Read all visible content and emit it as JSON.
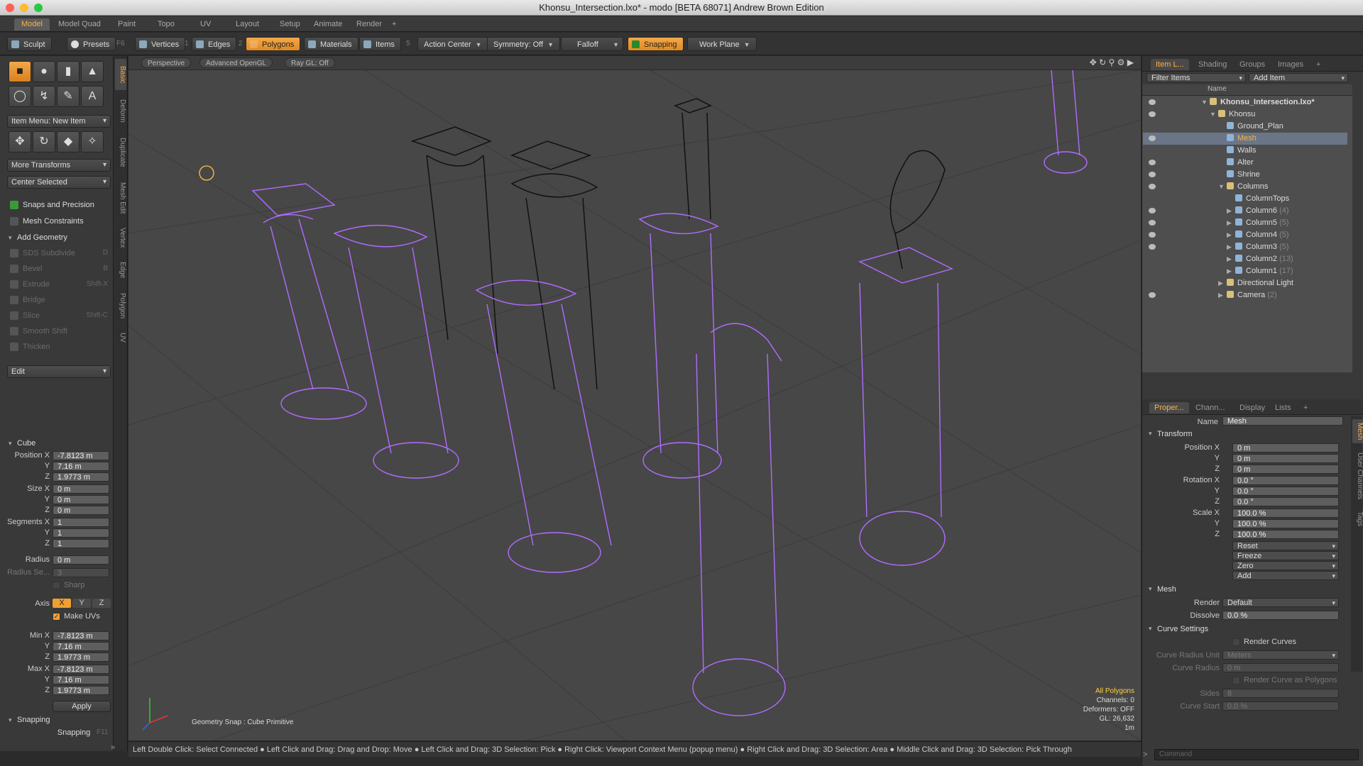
{
  "window": {
    "title": "Khonsu_Intersection.lxo* - modo [BETA 68071] Andrew Brown Edition"
  },
  "tabs": [
    "Model",
    "Model Quad",
    "Paint",
    "Topo",
    "UV",
    "Layout",
    "Setup",
    "Animate",
    "Render",
    "+"
  ],
  "toolbar": {
    "sculpt": "Sculpt",
    "presets": "Presets",
    "presets_key": "F6",
    "vertices": "Vertices",
    "vertices_key": "1",
    "edges": "Edges",
    "edges_key": "2",
    "polygons": "Polygons",
    "materials": "Materials",
    "items": "Items",
    "items_key": "5",
    "action_center": "Action Center",
    "symmetry": "Symmetry: Off",
    "falloff": "Falloff",
    "snapping": "Snapping",
    "work_plane": "Work Plane"
  },
  "left": {
    "vtabs": [
      "Basic",
      "Deform",
      "Duplicate",
      "Mesh Edit",
      "Vertex",
      "Edge",
      "Polygon",
      "UV"
    ],
    "item_menu": "Item Menu: New Item",
    "more_transforms": "More Transforms",
    "center_selected": "Center Selected",
    "snaps_precision": "Snaps and Precision",
    "mesh_constraints": "Mesh Constraints",
    "add_geometry": "Add Geometry",
    "tools": [
      {
        "label": "SDS Subdivide",
        "key": "D"
      },
      {
        "label": "Bevel",
        "key": "B"
      },
      {
        "label": "Extrude",
        "key": "Shift-X"
      },
      {
        "label": "Bridge",
        "key": ""
      },
      {
        "label": "Slice",
        "key": "Shift-C"
      },
      {
        "label": "Smooth Shift",
        "key": ""
      },
      {
        "label": "Thicken",
        "key": ""
      }
    ],
    "edit": "Edit",
    "cube": {
      "title": "Cube",
      "position_x_label": "Position X",
      "y_label": "Y",
      "z_label": "Z",
      "position": [
        "-7.8123 m",
        "7.16 m",
        "1.9773 m"
      ],
      "size_x_label": "Size X",
      "size": [
        "0 m",
        "0 m",
        "0 m"
      ],
      "segments_x_label": "Segments X",
      "segments": [
        "1",
        "1",
        "1"
      ],
      "radius_label": "Radius",
      "radius": "0 m",
      "radius_seg_label": "Radius Se...",
      "radius_seg": "3",
      "sharp_label": "Sharp",
      "axis_label": "Axis",
      "axis": [
        "X",
        "Y",
        "Z"
      ],
      "make_uvs": "Make UVs",
      "min_x_label": "Min X",
      "min": [
        "-7.8123 m",
        "7.16 m",
        "1.9773 m"
      ],
      "max_x_label": "Max X",
      "max": [
        "-7.8123 m",
        "7.16 m",
        "1.9773 m"
      ],
      "apply": "Apply"
    },
    "snapping_section": "Snapping",
    "snapping_btn": "Snapping",
    "snapping_key": "F11"
  },
  "viewport": {
    "labels": [
      "Perspective",
      "Advanced OpenGL",
      "Ray GL: Off"
    ],
    "geometry_snap": "Geometry Snap : Cube Primitive",
    "info": [
      "All Polygons",
      "Channels: 0",
      "Deformers: OFF",
      "GL: 26,632",
      "1m"
    ],
    "accent": "#b06cff"
  },
  "statusbar": "Left Double Click: Select Connected ● Left Click and Drag: Drag and Drop: Move ● Left Click and Drag: 3D Selection: Pick ● Right Click: Viewport Context Menu (popup menu) ● Right Click and Drag: 3D Selection: Area ● Middle Click and Drag: 3D Selection: Pick Through",
  "items_panel": {
    "tabs": [
      "Item L...",
      "Shading",
      "Groups",
      "Images",
      "+"
    ],
    "filter": "Filter Items",
    "add_item": "Add Item",
    "name_header": "Name",
    "tree": [
      {
        "name": "Khonsu_Intersection.lxo*",
        "count": ""
      },
      {
        "name": "Khonsu",
        "count": ""
      },
      {
        "name": "Ground_Plan",
        "count": ""
      },
      {
        "name": "Mesh",
        "count": ""
      },
      {
        "name": "Walls",
        "count": ""
      },
      {
        "name": "Alter",
        "count": ""
      },
      {
        "name": "Shrine",
        "count": ""
      },
      {
        "name": "Columns",
        "count": ""
      },
      {
        "name": "ColumnTops",
        "count": ""
      },
      {
        "name": "Column6",
        "count": "(4)"
      },
      {
        "name": "Column5",
        "count": "(5)"
      },
      {
        "name": "Column4",
        "count": "(5)"
      },
      {
        "name": "Column3",
        "count": "(5)"
      },
      {
        "name": "Column2",
        "count": "(13)"
      },
      {
        "name": "Column1",
        "count": "(17)"
      },
      {
        "name": "Directional Light",
        "count": ""
      },
      {
        "name": "Camera",
        "count": "(2)"
      }
    ]
  },
  "props_panel": {
    "tabs": [
      "Proper...",
      "Chann...",
      "Display",
      "Lists",
      "+"
    ],
    "vtabs": [
      "Mesh",
      "User Channels",
      "Tags"
    ],
    "name_label": "Name",
    "name": "Mesh",
    "transform": "Transform",
    "position_label": "Position X",
    "y": "Y",
    "z": "Z",
    "position": [
      "0 m",
      "0 m",
      "0 m"
    ],
    "rotation_label": "Rotation X",
    "rotation": [
      "0.0 °",
      "0.0 °",
      "0.0 °"
    ],
    "scale_label": "Scale X",
    "scale": [
      "100.0 %",
      "100.0 %",
      "100.0 %"
    ],
    "actions": [
      "Reset",
      "Freeze",
      "Zero",
      "Add"
    ],
    "mesh": "Mesh",
    "render_label": "Render",
    "render": "Default",
    "dissolve_label": "Dissolve",
    "dissolve": "0.0 %",
    "curve_settings": "Curve Settings",
    "render_curves": "Render Curves",
    "curve_radius_unit_label": "Curve Radius Unit",
    "curve_radius_unit": "Meters",
    "curve_radius_label": "Curve Radius",
    "curve_radius": "0 m",
    "render_curve_polys": "Render Curve as Polygons",
    "sides_label": "Sides",
    "sides": "8",
    "curve_start_label": "Curve Start",
    "curve_start": "0.0 %",
    "command": "Command"
  }
}
